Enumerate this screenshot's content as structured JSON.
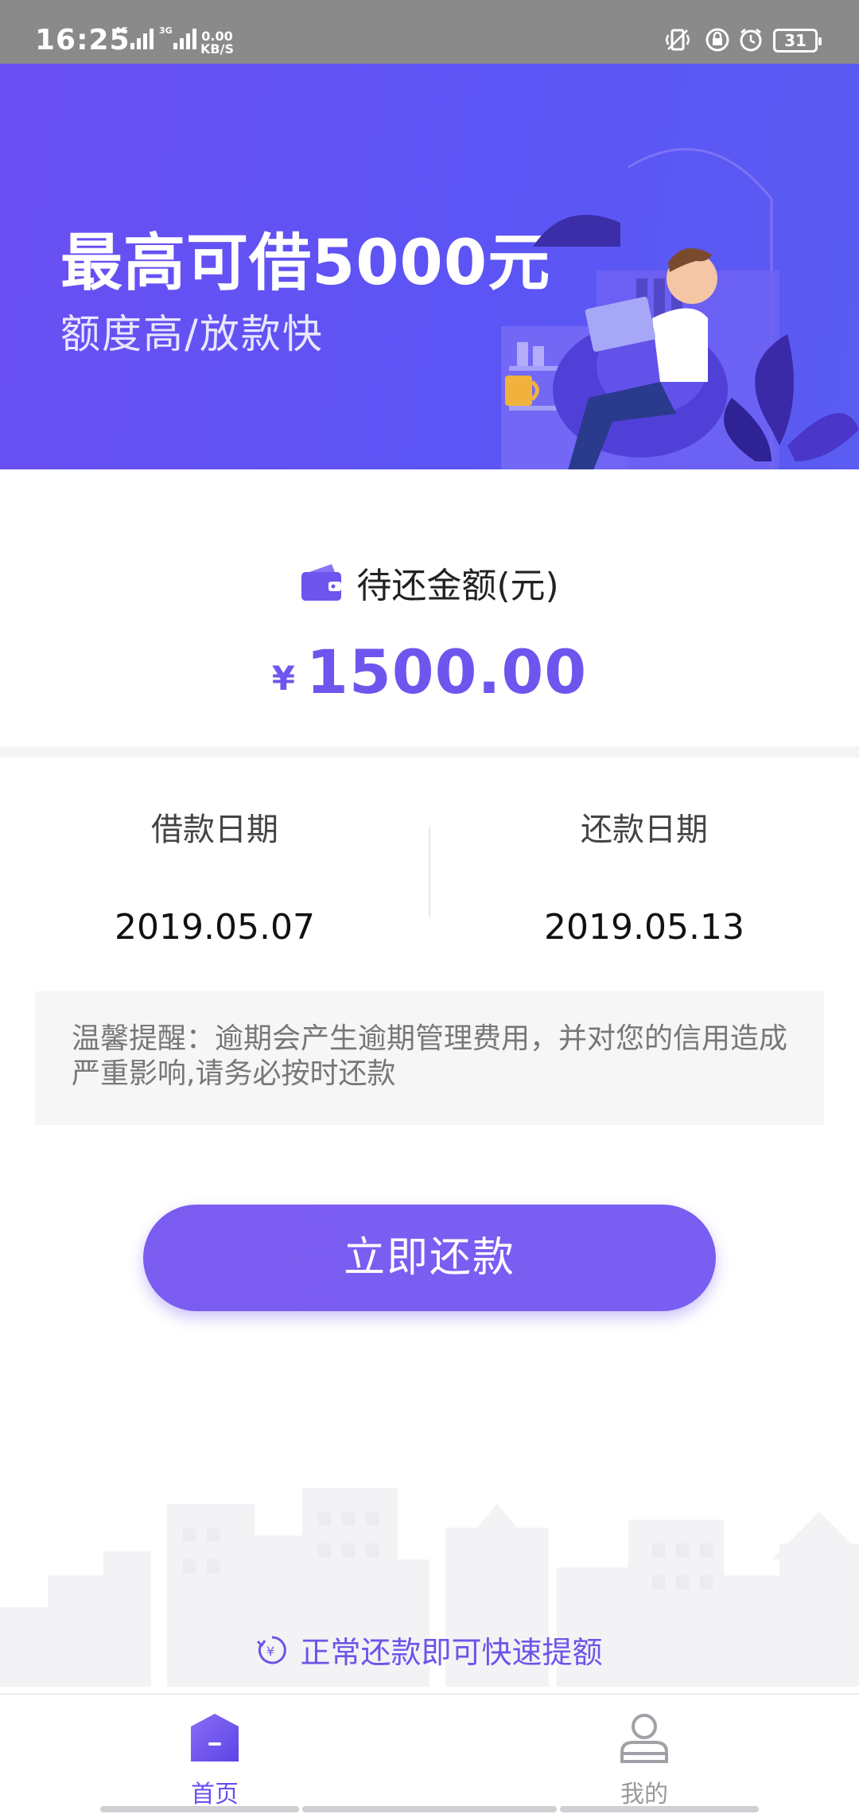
{
  "status_bar": {
    "time": "16:25",
    "net_4g": "4G",
    "net_3g": "3G",
    "speed_value": "0.00",
    "speed_unit": "KB/S",
    "battery": "31"
  },
  "banner": {
    "title": "最高可借5000元",
    "subtitle": "额度高/放款快"
  },
  "amount": {
    "label": "待还金额(元)",
    "currency": "¥",
    "value": "1500.00"
  },
  "dates": {
    "borrow_label": "借款日期",
    "borrow_value": "2019.05.07",
    "repay_label": "还款日期",
    "repay_value": "2019.05.13"
  },
  "notice": {
    "text": "温馨提醒：逾期会产生逾期管理费用，并对您的信用造成严重影响,请务必按时还款"
  },
  "actions": {
    "repay_button": "立即还款"
  },
  "tip": {
    "text": "正常还款即可快速提额"
  },
  "bottom_nav": {
    "items": [
      {
        "label": "首页",
        "icon": "home-icon",
        "active": true
      },
      {
        "label": "我的",
        "icon": "user-icon",
        "active": false
      }
    ]
  },
  "colors": {
    "accent": "#6e55ee",
    "banner_start": "#6b4ff2",
    "banner_end": "#5a5cf2"
  }
}
